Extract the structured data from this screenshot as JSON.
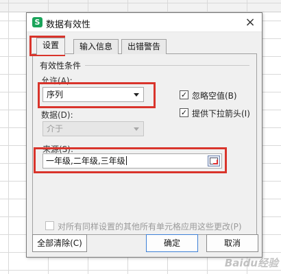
{
  "dialog": {
    "title": "数据有效性",
    "app_icon_letter": "S",
    "close_glyph": "×"
  },
  "tabs": [
    {
      "label": "设置",
      "active": true
    },
    {
      "label": "输入信息",
      "active": false
    },
    {
      "label": "出错警告",
      "active": false
    }
  ],
  "criteria": {
    "group_title": "有效性条件",
    "allow_label": "允许(A):",
    "allow_value": "序列",
    "data_label": "数据(D):",
    "data_value": "介于",
    "ignore_blank_label": "忽略空值(B)",
    "ignore_blank_checked": true,
    "dropdown_label": "提供下拉箭头(I)",
    "dropdown_checked": true,
    "source_label": "来源(S):",
    "source_value": "一年级,二年级,三年级"
  },
  "apply_all": {
    "label": "对所有同样设置的其他所有单元格应用这些更改(P)",
    "checked": false
  },
  "buttons": {
    "clear_all": "全部清除(C)",
    "ok": "确定",
    "cancel": "取消"
  },
  "watermark": "Baidu经验",
  "colors": {
    "highlight": "#d9342b",
    "app_icon": "#1aa45a",
    "primary_border": "#3c7fd6"
  }
}
